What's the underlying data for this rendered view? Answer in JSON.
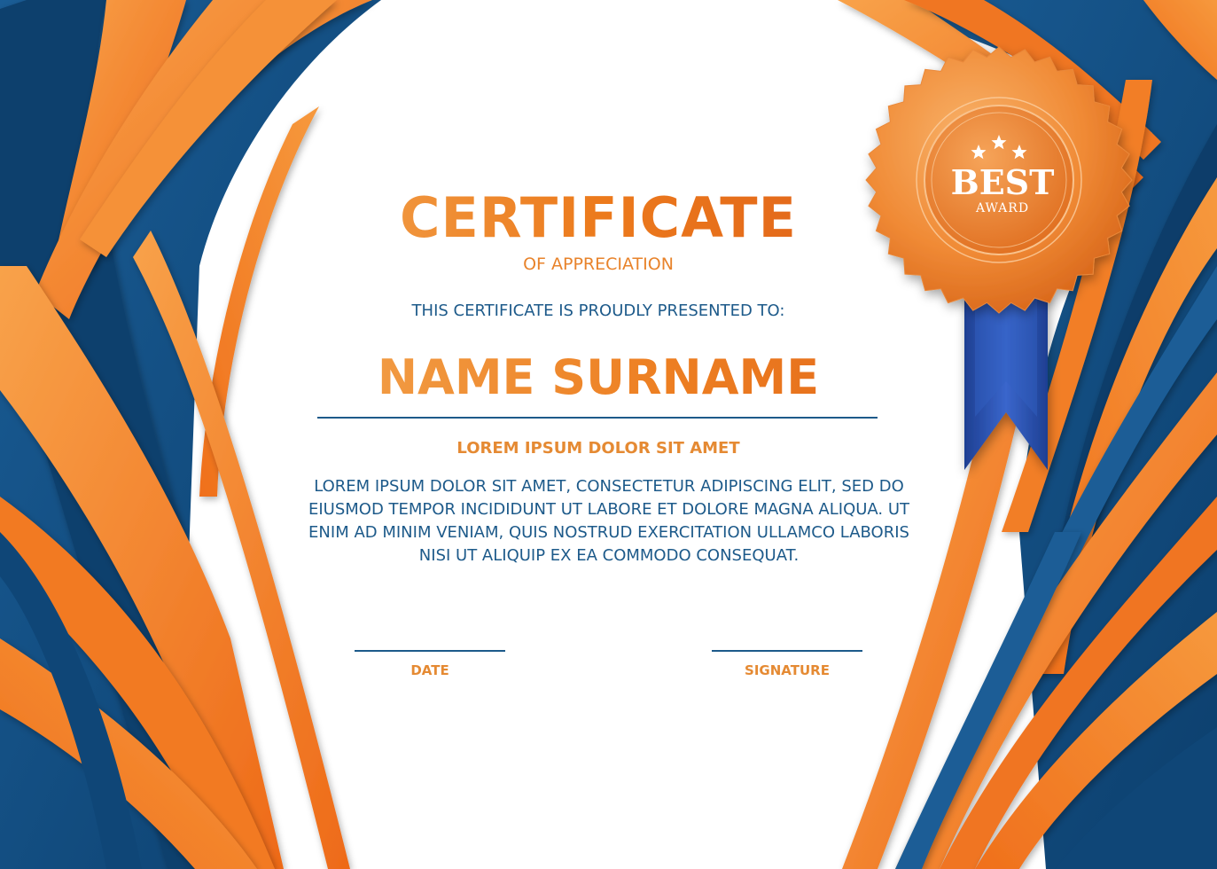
{
  "certificate": {
    "title": "CERTIFICATE",
    "subtitle": "OF APPRECIATION",
    "presented_to": "THIS CERTIFICATE IS PROUDLY PRESENTED TO:",
    "recipient_name": "NAME SURNAME",
    "heading": "LOREM IPSUM DOLOR SIT AMET",
    "body_lines": [
      "LOREM IPSUM DOLOR SIT AMET, CONSECTETUR ADIPISCING ELIT, SED DO",
      "EIUSMOD TEMPOR INCIDIDUNT UT LABORE ET DOLORE MAGNA ALIQUA. UT",
      "ENIM AD MINIM VENIAM, QUIS NOSTRUD EXERCITATION ULLAMCO LABORIS",
      "NISI UT ALIQUIP EX EA COMMODO CONSEQUAT."
    ],
    "date_label": "DATE",
    "signature_label": "SIGNATURE"
  },
  "badge": {
    "title": "BEST",
    "subtitle": "AWARD",
    "stars": 3,
    "icon": "award-seal-icon"
  },
  "colors": {
    "orange": "#ef7d1f",
    "orange_light": "#f6a04c",
    "blue_dark": "#0f4677",
    "blue": "#1d5a8a",
    "ribbon_blue": "#2a56b8"
  }
}
